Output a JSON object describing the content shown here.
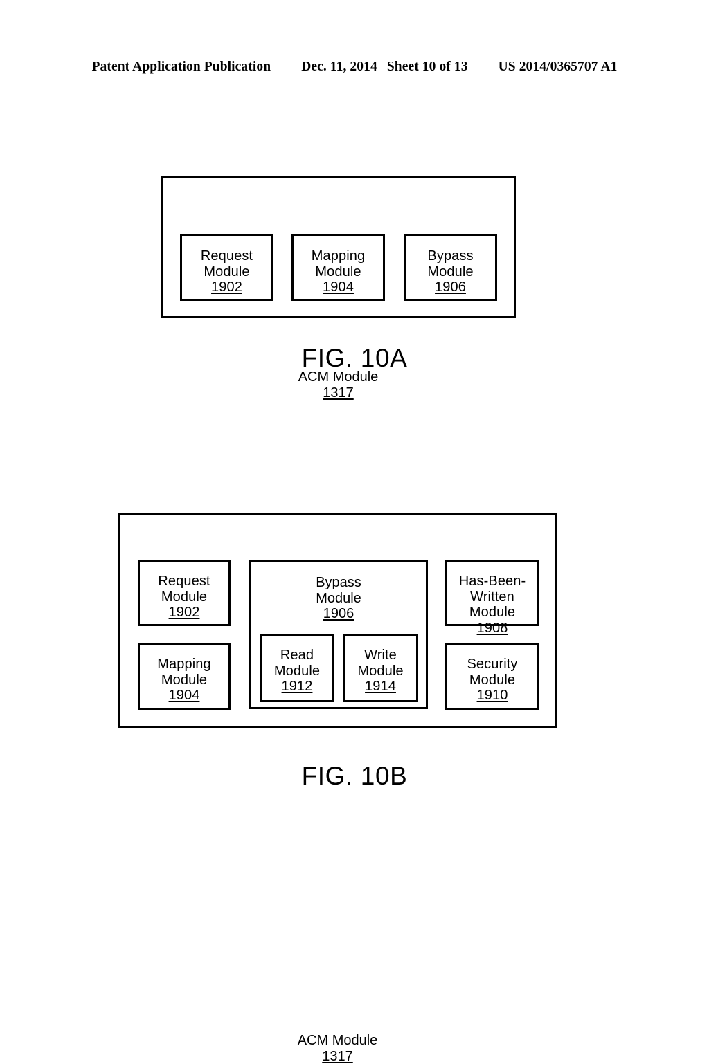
{
  "header": {
    "publication": "Patent Application Publication",
    "date": "Dec. 11, 2014",
    "sheet": "Sheet 10 of 13",
    "patent_number": "US 2014/0365707 A1"
  },
  "figures": [
    {
      "caption": "FIG. 10A",
      "container": {
        "title": "ACM Module",
        "ref": "1317"
      },
      "modules": [
        {
          "name": "Request",
          "suffix": "Module",
          "ref": "1902"
        },
        {
          "name": "Mapping",
          "suffix": "Module",
          "ref": "1904"
        },
        {
          "name": "Bypass",
          "suffix": "Module",
          "ref": "1906"
        }
      ]
    },
    {
      "caption": "FIG. 10B",
      "container": {
        "title": "ACM Module",
        "ref": "1317"
      },
      "left_column": [
        {
          "name": "Request",
          "suffix": "Module",
          "ref": "1902"
        },
        {
          "name": "Mapping",
          "suffix": "Module",
          "ref": "1904"
        }
      ],
      "center": {
        "name": "Bypass",
        "suffix": "Module",
        "ref": "1906",
        "children": [
          {
            "name": "Read",
            "suffix": "Module",
            "ref": "1912"
          },
          {
            "name": "Write",
            "suffix": "Module",
            "ref": "1914"
          }
        ]
      },
      "right_column": [
        {
          "name": "Has-Been-",
          "suffix": "Written Module",
          "ref": "1908"
        },
        {
          "name": "Security",
          "suffix": "Module",
          "ref": "1910"
        }
      ]
    }
  ],
  "colors": {
    "line": "#000000",
    "background": "#ffffff",
    "text": "#000000"
  }
}
